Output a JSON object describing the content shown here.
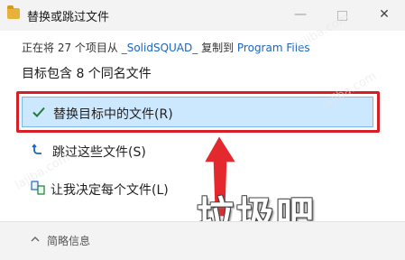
{
  "window": {
    "title": "替换或跳过文件",
    "minimize_glyph": "—",
    "close_glyph": "✕"
  },
  "status": {
    "prefix": "正在将 27 个项目从 ",
    "source": "_SolidSQUAD_",
    "middle": " 复制到 ",
    "destination": "Program Files"
  },
  "subheading": "目标包含 8 个同名文件",
  "options": [
    {
      "label": "替换目标中的文件(R)",
      "icon": "check-icon",
      "selected": true
    },
    {
      "label": "跳过这些文件(S)",
      "icon": "skip-arrow-icon",
      "selected": false
    },
    {
      "label": "让我决定每个文件(L)",
      "icon": "compare-files-icon",
      "selected": false
    }
  ],
  "footer": {
    "details_label": "简略信息"
  },
  "overlay": {
    "stamp_text": "垃圾吧"
  },
  "colors": {
    "accent": "#1a66c2",
    "selected_bg": "#cce8ff",
    "highlight_red": "#d61f26"
  }
}
